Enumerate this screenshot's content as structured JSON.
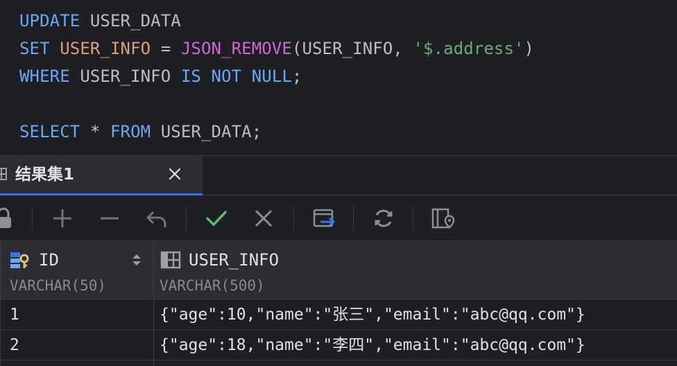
{
  "editor": {
    "line1": {
      "kw1": "UPDATE",
      "table": "USER_DATA"
    },
    "line2": {
      "kw1": "SET",
      "col": "USER_INFO",
      "eq": "=",
      "fn": "JSON_REMOVE",
      "args_open": "(USER_INFO, ",
      "arg_str": "'$.address'",
      "args_close": ")"
    },
    "line3": {
      "kw1": "WHERE",
      "col": "USER_INFO",
      "kw2": "IS",
      "kw3": "NOT",
      "kw4": "NULL",
      "semi": ";"
    },
    "line5": {
      "kw1": "SELECT",
      "star": "*",
      "kw2": "FROM",
      "table": "USER_DATA",
      "semi": ";"
    }
  },
  "result_tab": {
    "label": "结果集1"
  },
  "grid": {
    "columns": [
      {
        "name": "ID",
        "type": "VARCHAR(50)"
      },
      {
        "name": "USER_INFO",
        "type": "VARCHAR(500)"
      }
    ],
    "rows": [
      {
        "id": "1",
        "user_info": "{\"age\":10,\"name\":\"张三\",\"email\":\"abc@qq.com\"}"
      },
      {
        "id": "2",
        "user_info": "{\"age\":18,\"name\":\"李四\",\"email\":\"abc@qq.com\"}"
      }
    ]
  },
  "colors": {
    "accent": "#3574f0",
    "keyword": "#6aa8f5",
    "function": "#d265d4",
    "column": "#d9a07c",
    "string": "#6aab73",
    "confirm": "#5fb865"
  },
  "icons": {
    "tab": "table-icon",
    "close": "close-icon",
    "toolbar": [
      "lock-icon",
      "plus-icon",
      "minus-icon",
      "revert-icon",
      "check-icon",
      "cancel-icon",
      "export-icon",
      "refresh-icon",
      "view-icon"
    ]
  }
}
